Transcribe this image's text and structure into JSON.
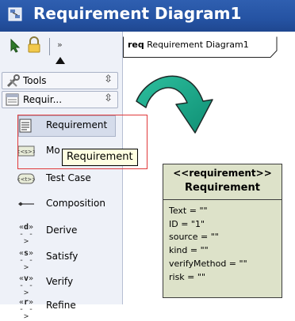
{
  "window": {
    "title": "Requirement Diagram1"
  },
  "palette": {
    "toolbar": {
      "more_label": "»"
    },
    "sections": [
      {
        "label": "Tools",
        "control": "⇳"
      },
      {
        "label": "Requir...",
        "control": "⇳"
      }
    ],
    "items": [
      {
        "label": "Requirement",
        "icon": "requirement-icon"
      },
      {
        "label": "Mo",
        "icon": "model-icon",
        "icon_text": "<<s>>"
      },
      {
        "label": "Test Case",
        "icon": "test-case-icon",
        "icon_text": "<<t>>"
      },
      {
        "label": "Composition",
        "icon": "composition-icon"
      },
      {
        "label": "Derive",
        "icon": "derive-icon",
        "icon_text": "d"
      },
      {
        "label": "Satisfy",
        "icon": "satisfy-icon",
        "icon_text": "s"
      },
      {
        "label": "Verify",
        "icon": "verify-icon",
        "icon_text": "v"
      },
      {
        "label": "Refine",
        "icon": "refine-icon",
        "icon_text": "r"
      }
    ]
  },
  "tooltip": {
    "text": "Requirement"
  },
  "diagram": {
    "tab_keyword": "req",
    "tab_name": "Requirement Diagram1",
    "element": {
      "stereotype": "<<requirement>>",
      "name": "Requirement",
      "properties": [
        "Text = \"\"",
        "ID = \"1\"",
        "source = \"\"",
        "kind = \"\"",
        "verifyMethod = \"\"",
        "risk = \"\""
      ]
    }
  },
  "colors": {
    "title_bar": "#2553a3",
    "palette_bg": "#eef1f8",
    "highlight": "#e0393a",
    "tooltip_bg": "#ffffe1",
    "requirement_fill": "#dde2c9",
    "arrow_fill": "#19a98a"
  }
}
